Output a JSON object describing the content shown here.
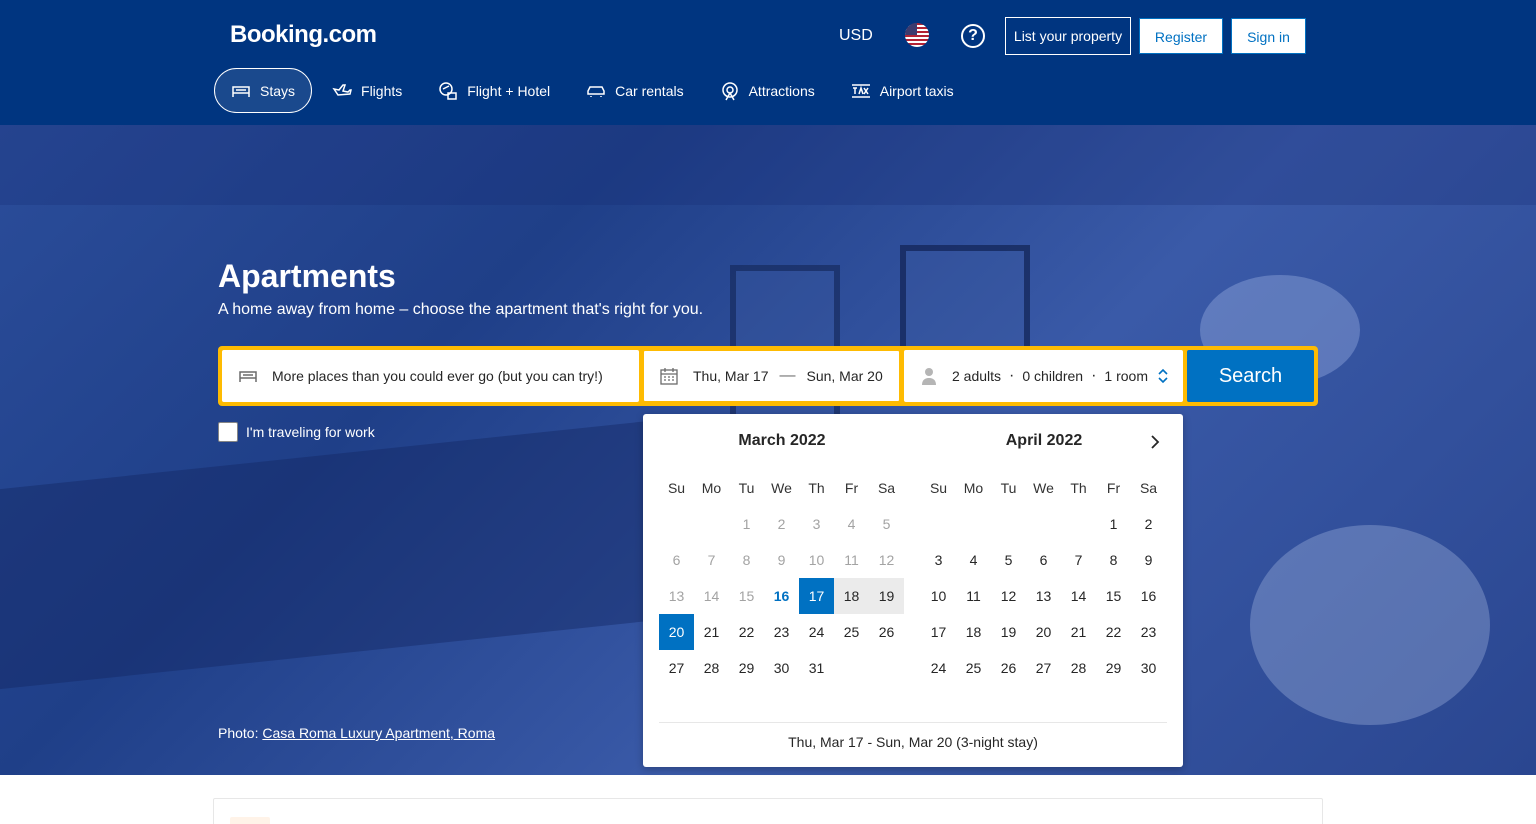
{
  "header": {
    "logo": "Booking.com",
    "currency": "USD",
    "list_property": "List your property",
    "register": "Register",
    "sign_in": "Sign in"
  },
  "nav": {
    "items": [
      {
        "label": "Stays",
        "icon": "bed-icon",
        "active": true
      },
      {
        "label": "Flights",
        "icon": "plane-icon",
        "active": false
      },
      {
        "label": "Flight + Hotel",
        "icon": "flight-hotel-icon",
        "active": false
      },
      {
        "label": "Car rentals",
        "icon": "car-icon",
        "active": false
      },
      {
        "label": "Attractions",
        "icon": "attractions-icon",
        "active": false
      },
      {
        "label": "Airport taxis",
        "icon": "taxi-icon",
        "active": false
      }
    ]
  },
  "hero": {
    "title": "Apartments",
    "subtitle": "A home away from home – choose the apartment that's right for you.",
    "photo_label": "Photo:",
    "photo_link": "Casa Roma Luxury Apartment, Roma"
  },
  "search": {
    "destination_placeholder": "More places than you could ever go (but you can try!)",
    "checkin": "Thu, Mar 17",
    "dash": "—",
    "checkout": "Sun, Mar 20",
    "adults": "2 adults",
    "children": "0 children",
    "rooms": "1 room",
    "dot": "·",
    "button": "Search",
    "work_label": "I'm traveling for work"
  },
  "calendar": {
    "weekdays": [
      "Su",
      "Mo",
      "Tu",
      "We",
      "Th",
      "Fr",
      "Sa"
    ],
    "months": [
      {
        "title": "March 2022",
        "offset": 2,
        "days": 31,
        "past_until": 15,
        "today": 16,
        "selected": [
          17,
          20
        ],
        "range": [
          18,
          19
        ]
      },
      {
        "title": "April 2022",
        "offset": 5,
        "days": 30,
        "past_until": 0,
        "today": 0,
        "selected": [],
        "range": []
      }
    ],
    "summary": "Thu, Mar 17 - Sun, Mar 20 (3-night stay)"
  },
  "colors": {
    "brand_blue": "#003580",
    "accent_blue": "#0071c2",
    "search_yellow": "#febb02"
  }
}
